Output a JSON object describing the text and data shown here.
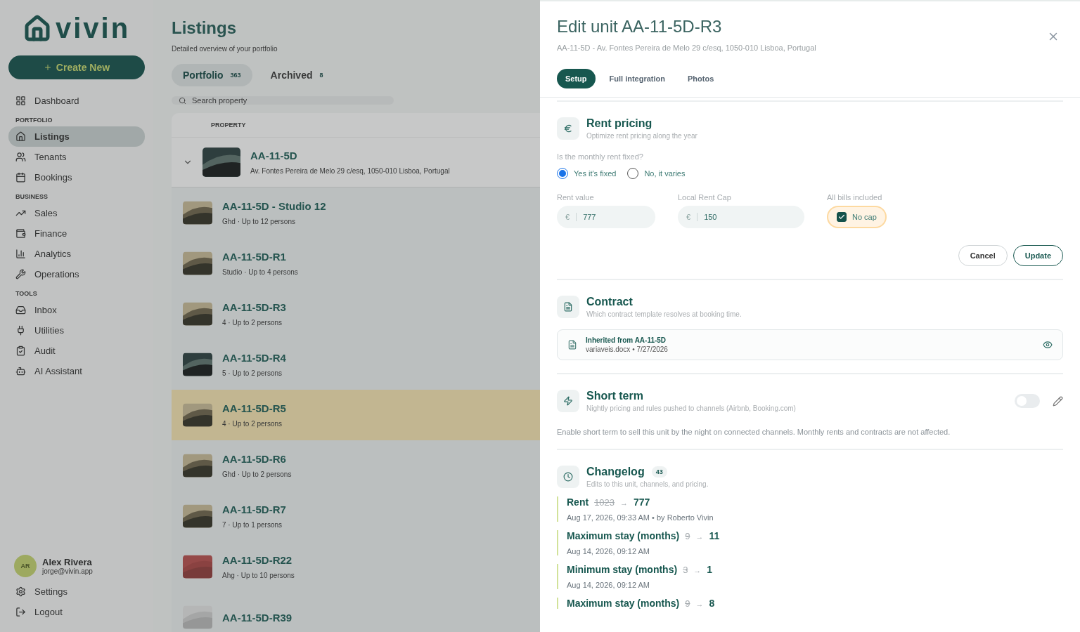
{
  "sidebar": {
    "logo": "vivin",
    "create_button": "Create New",
    "nav": [
      {
        "kind": "item",
        "label": "Dashboard",
        "selected": false
      },
      {
        "kind": "section",
        "label": "PORTFOLIO"
      },
      {
        "kind": "item",
        "label": "Listings",
        "selected": true
      },
      {
        "kind": "item",
        "label": "Tenants",
        "selected": false
      },
      {
        "kind": "item",
        "label": "Bookings",
        "selected": false
      },
      {
        "kind": "section",
        "label": "BUSINESS"
      },
      {
        "kind": "item",
        "label": "Sales",
        "selected": false
      },
      {
        "kind": "item",
        "label": "Finance",
        "selected": false
      },
      {
        "kind": "item",
        "label": "Analytics",
        "selected": false
      },
      {
        "kind": "item",
        "label": "Operations",
        "selected": false
      },
      {
        "kind": "section",
        "label": "TOOLS"
      },
      {
        "kind": "item",
        "label": "Inbox",
        "selected": false
      },
      {
        "kind": "item",
        "label": "Utilities",
        "selected": false
      },
      {
        "kind": "item",
        "label": "Audit",
        "selected": false
      },
      {
        "kind": "item",
        "label": "AI Assistant",
        "selected": false
      }
    ],
    "user": {
      "initials": "AR",
      "name": "Alex Rivera",
      "email": "jorge@vivin.app"
    },
    "footer": [
      {
        "label": "Settings"
      },
      {
        "label": "Logout"
      }
    ]
  },
  "listings": {
    "title": "Listings",
    "subtitle": "Detailed overview of your portfolio",
    "tabs": [
      {
        "label": "Portfolio",
        "count": "363",
        "selected": true
      },
      {
        "label": "Archived",
        "count": "8",
        "selected": false
      }
    ],
    "search": {
      "placeholder": "Search property"
    },
    "columns": [
      "PROPERTY"
    ],
    "parent": {
      "name": "AA-11-5D",
      "address": "Av. Fontes Pereira de Melo 29 c/esq, 1050-010 Lisboa, Portugal"
    },
    "rows": [
      {
        "name": "AA-11-5D - Studio 12",
        "detail": "Ghd · Up to 12 persons",
        "selected": false
      },
      {
        "name": "AA-11-5D-R1",
        "detail": "Studio · Up to 4 persons",
        "selected": false
      },
      {
        "name": "AA-11-5D-R3",
        "detail": "4 · Up to 2 persons",
        "selected": false
      },
      {
        "name": "AA-11-5D-R4",
        "detail": "5 · Up to 2 persons",
        "selected": false
      },
      {
        "name": "AA-11-5D-R5",
        "detail": "4 · Up to 2 persons",
        "selected": true
      },
      {
        "name": "AA-11-5D-R6",
        "detail": "Ghd · Up to 2 persons",
        "selected": false
      },
      {
        "name": "AA-11-5D-R7",
        "detail": "7 · Up to 1 persons",
        "selected": false
      },
      {
        "name": "AA-11-5D-R22",
        "detail": "Ahg · Up to 10 persons",
        "selected": false
      },
      {
        "name": "AA-11-5D-R39",
        "selected": false
      }
    ]
  },
  "drawer": {
    "title": "Edit unit AA-11-5D-R3",
    "subtitle": "AA-11-5D - Av. Fontes Pereira de Melo 29 c/esq, 1050-010 Lisboa, Portugal",
    "tabs": [
      {
        "label": "Setup",
        "selected": true
      },
      {
        "label": "Full integration",
        "selected": false
      },
      {
        "label": "Photos",
        "selected": false
      }
    ],
    "rent_pricing": {
      "title": "Rent pricing",
      "subtitle": "Optimize rent pricing along the year",
      "question": "Is the monthly rent fixed?",
      "options": [
        {
          "label": "Yes it's fixed",
          "selected": true
        },
        {
          "label": "No, it varies",
          "selected": false
        }
      ],
      "fields": [
        {
          "label": "Rent value",
          "prefix": "€",
          "value": "777"
        },
        {
          "label": "Local Rent Cap",
          "prefix": "€",
          "value": "150"
        }
      ],
      "bills": {
        "label": "All bills included",
        "option": "No cap",
        "checked": true
      },
      "buttons": [
        {
          "label": "Cancel",
          "kind": "secondary"
        },
        {
          "label": "Update",
          "kind": "primary"
        }
      ]
    },
    "contract": {
      "title": "Contract",
      "subtitle": "Which contract template resolves at booking time.",
      "source": "Inherited from AA-11-5D",
      "file": "variaveis.docx • 7/27/2026"
    },
    "short_term": {
      "title": "Short term",
      "subtitle": "Nightly pricing and rules pushed to channels (Airbnb, Booking.com)",
      "on": false,
      "description": "Enable short term to sell this unit by the night on connected channels. Monthly rents and contracts are not affected."
    },
    "changelog": {
      "title": "Changelog",
      "count": "43",
      "subtitle": "Edits to this unit, channels, and pricing.",
      "entries": [
        {
          "field": "Rent",
          "old": "1023",
          "arrow": "→",
          "new": "777",
          "meta": "Aug 17, 2026, 09:33 AM • by Roberto Vivin"
        },
        {
          "field": "Maximum stay (months)",
          "old": "9",
          "arrow": "→",
          "new": "11",
          "meta": "Aug 14, 2026, 09:12 AM"
        },
        {
          "field": "Minimum stay (months)",
          "old": "3",
          "arrow": "→",
          "new": "1",
          "meta": "Aug 14, 2026, 09:12 AM"
        },
        {
          "field": "Maximum stay (months)",
          "old": "9",
          "arrow": "→",
          "new": "8"
        }
      ]
    }
  }
}
